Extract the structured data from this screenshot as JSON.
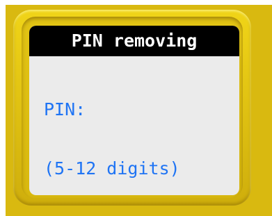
{
  "screen": {
    "title": "PIN removing",
    "pin_label": "PIN:",
    "pin_hint": "(5-12 digits)"
  },
  "colors": {
    "bezel": "#d9b910",
    "title_bar": "#000000",
    "title_text": "#ffffff",
    "screen_bg": "#ebebeb",
    "text_accent": "#1f74f4"
  }
}
